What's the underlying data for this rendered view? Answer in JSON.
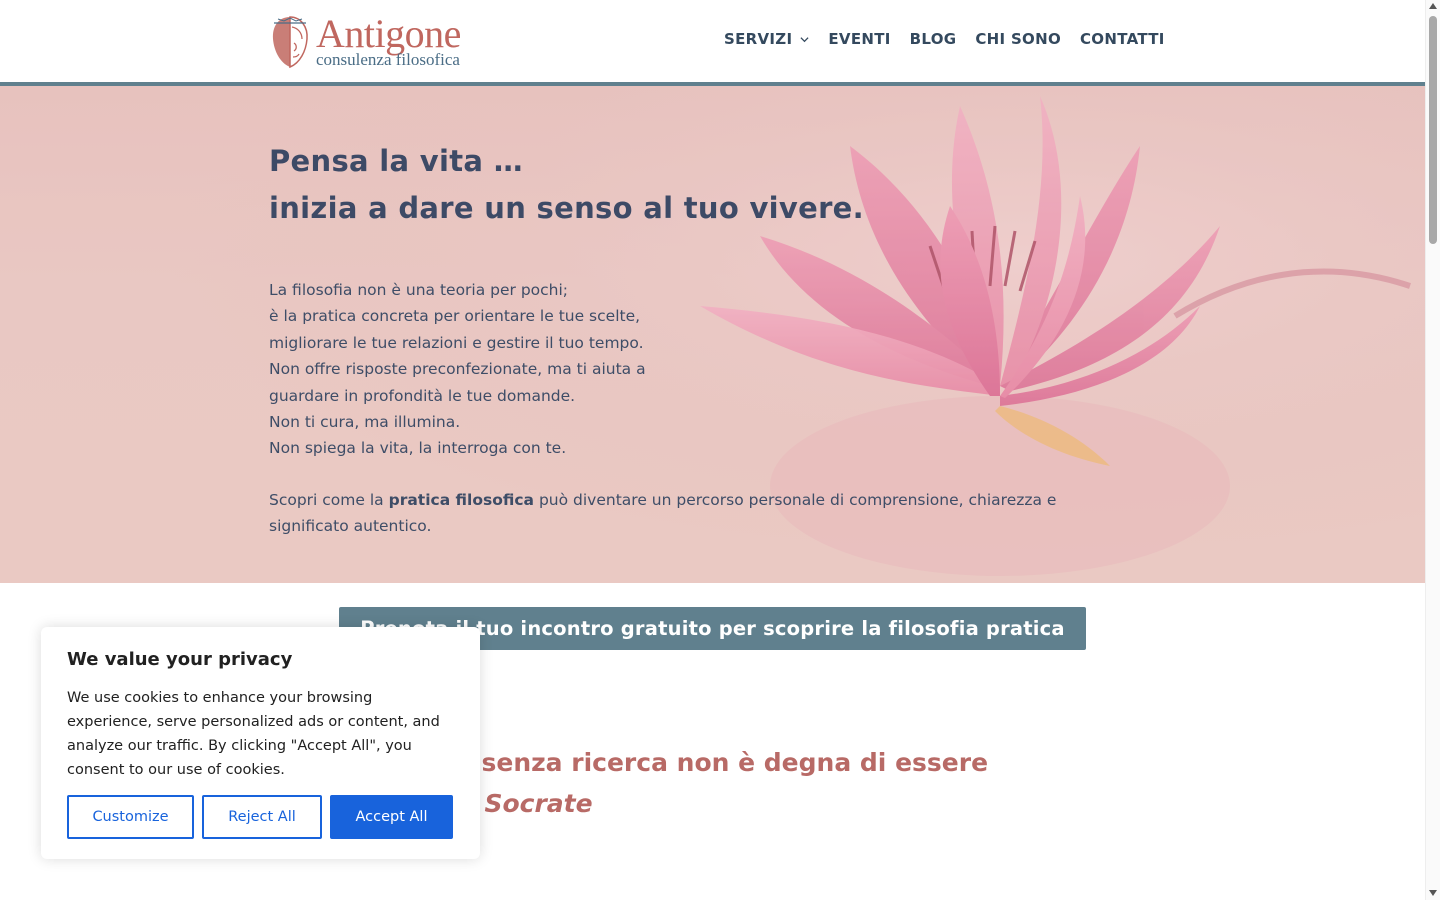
{
  "header": {
    "logo_title": "Antigone",
    "logo_subtitle": "consulenza filosofica",
    "nav": [
      {
        "label": "SERVIZI",
        "has_dropdown": true
      },
      {
        "label": "EVENTI"
      },
      {
        "label": "BLOG"
      },
      {
        "label": "CHI SONO"
      },
      {
        "label": "CONTATTI"
      }
    ]
  },
  "hero": {
    "title_line1": "Pensa la vita …",
    "title_line2": "inizia a dare un senso al tuo vivere.",
    "body_lines": [
      "La filosofia non è una teoria per pochi;",
      "è la pratica concreta per orientare le tue scelte,",
      "migliorare le tue relazioni e gestire il tuo tempo.",
      "Non offre risposte preconfezionate, ma ti aiuta a",
      "guardare in profondità le tue domande.",
      "Non ti cura, ma illumina.",
      "Non spiega la vita, la interroga con te."
    ],
    "cta_prefix": "Scopri come la ",
    "cta_bold": "pratica filosofica",
    "cta_suffix": " può diventare un percorso personale di comprensione, chiarezza e significato autentico."
  },
  "cta_button": {
    "label": "Prenota il tuo incontro gratuito per scoprire la filosofia pratica"
  },
  "quote": {
    "text": "“Una vita senza ricerca non è degna di essere vissuta” - ",
    "author": "Socrate"
  },
  "cookie_banner": {
    "title": "We value your privacy",
    "text": "We use cookies to enhance your browsing experience, serve personalized ads or content, and analyze our traffic. By clicking \"Accept All\", you consent to our use of cookies.",
    "customize_label": "Customize",
    "reject_label": "Reject All",
    "accept_label": "Accept All"
  },
  "colors": {
    "accent_bar": "#60808e",
    "logo": "#c0675f",
    "quote": "#b86a66",
    "cookie_primary": "#1863dc"
  },
  "icons": [
    "chevron-down-icon",
    "logo-face-icon",
    "lotus-flower-image"
  ]
}
